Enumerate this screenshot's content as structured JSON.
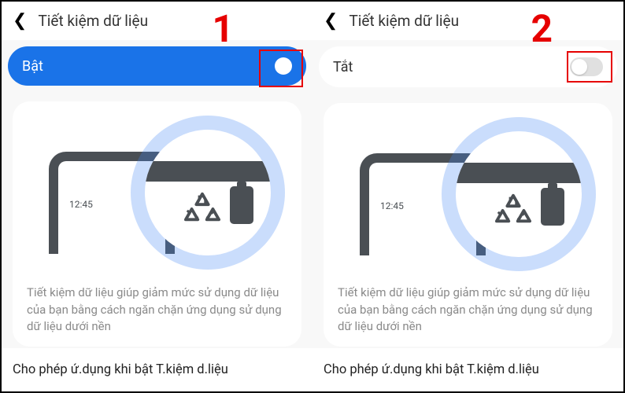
{
  "panels": [
    {
      "step": "1",
      "title": "Tiết kiệm dữ liệu",
      "toggle_label": "Bật",
      "toggle_state": "on",
      "phone_time": "12:45",
      "description": "Tiết kiệm dữ liệu giúp giảm mức sử dụng dữ liệu của bạn bằng cách ngăn chặn ứng dụng sử dụng dữ liệu dưới nền",
      "allow_label": "Cho phép ứ.dụng khi bật T.kiệm d.liệu"
    },
    {
      "step": "2",
      "title": "Tiết kiệm dữ liệu",
      "toggle_label": "Tắt",
      "toggle_state": "off",
      "phone_time": "12:45",
      "description": "Tiết kiệm dữ liệu giúp giảm mức sử dụng dữ liệu của bạn bằng cách ngăn chặn ứng dụng sử dụng dữ liệu dưới nền",
      "allow_label": "Cho phép ứ.dụng khi bật T.kiệm d.liệu"
    }
  ],
  "colors": {
    "accent_on": "#1a73e8",
    "step_red": "#e60000"
  }
}
